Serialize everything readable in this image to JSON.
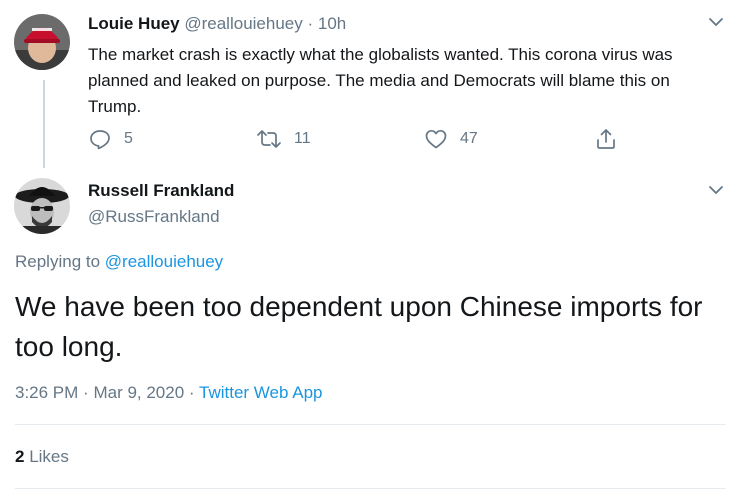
{
  "parent_tweet": {
    "display_name": "Louie Huey",
    "handle": "@reallouiehuey",
    "separator": "·",
    "time_ago": "10h",
    "text": "The market crash is exactly what the globalists wanted. This corona virus was planned and leaked on purpose. The media and Democrats will blame this on Trump.",
    "actions": {
      "reply_count": "5",
      "retweet_count": "11",
      "like_count": "47"
    }
  },
  "main_tweet": {
    "display_name": "Russell Frankland",
    "handle": "@RussFrankland",
    "replying_prefix": "Replying to",
    "replying_to": "@reallouiehuey",
    "text": "We have been too dependent upon Chinese imports for too long.",
    "time": "3:26 PM",
    "date": "Mar 9, 2020",
    "separator": "·",
    "source": "Twitter Web App",
    "likes_count": "2",
    "likes_label": "Likes"
  },
  "colors": {
    "link": "#1b95e0",
    "muted": "#657786",
    "text": "#14171a",
    "divider": "#e6ecf0"
  },
  "icons": {
    "reply": "reply-icon",
    "retweet": "retweet-icon",
    "like": "heart-icon",
    "share": "share-icon",
    "caret": "chevron-down-icon"
  }
}
